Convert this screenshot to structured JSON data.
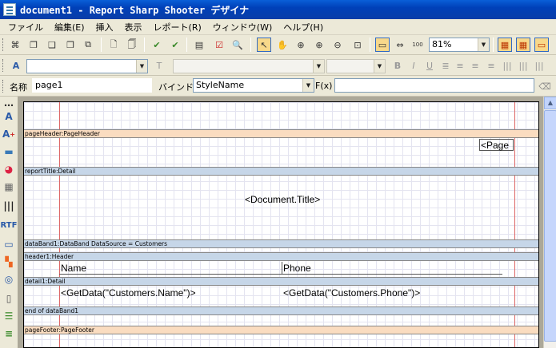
{
  "window": {
    "title": "document1 - Report Sharp Shooter デザイナ"
  },
  "menu": [
    "ファイル",
    "編集(E)",
    "挿入",
    "表示",
    "レポート(R)",
    "ウィンドウ(W)",
    "ヘルプ(H)"
  ],
  "toolbar": {
    "zoom": "81%"
  },
  "format": {
    "bold": "B",
    "italic": "I",
    "underline": "U"
  },
  "props": {
    "name_label": "名称",
    "name_value": "page1",
    "bind_label": "バインド",
    "bind_value": "StyleName",
    "fx_label": "F(x)",
    "fx_value": ""
  },
  "bands": {
    "pageHeader": "pageHeader:PageHeader",
    "reportTitle": "reportTitle:Detail",
    "dataBand": "dataBand1:DataBand  DataSource = Customers",
    "header": "header1:Header",
    "detail": "detail1:Detail",
    "endBand": "end of dataBand1",
    "pageFooter": "pageFooter:PageFooter"
  },
  "fields": {
    "page": "<Page",
    "title": "<Document.Title>",
    "col_name": "Name",
    "col_phone": "Phone",
    "get_name": "<GetData(\"Customers.Name\")>",
    "get_phone": "<GetData(\"Customers.Phone\")>"
  },
  "left_tools": [
    "text-tool-icon",
    "richtext-icon",
    "image-icon",
    "chart-icon",
    "shape-icon",
    "barcode-icon",
    "rtf-icon",
    "panel-icon",
    "crosstab-icon",
    "gauge-icon",
    "page-icon",
    "databand-icon",
    "band-icon"
  ],
  "colors": {
    "title_bar": "#0a3ea8",
    "band_orange": "#fadcc0",
    "band_blue": "#c6d6e8",
    "margin_line": "#dd6666"
  }
}
